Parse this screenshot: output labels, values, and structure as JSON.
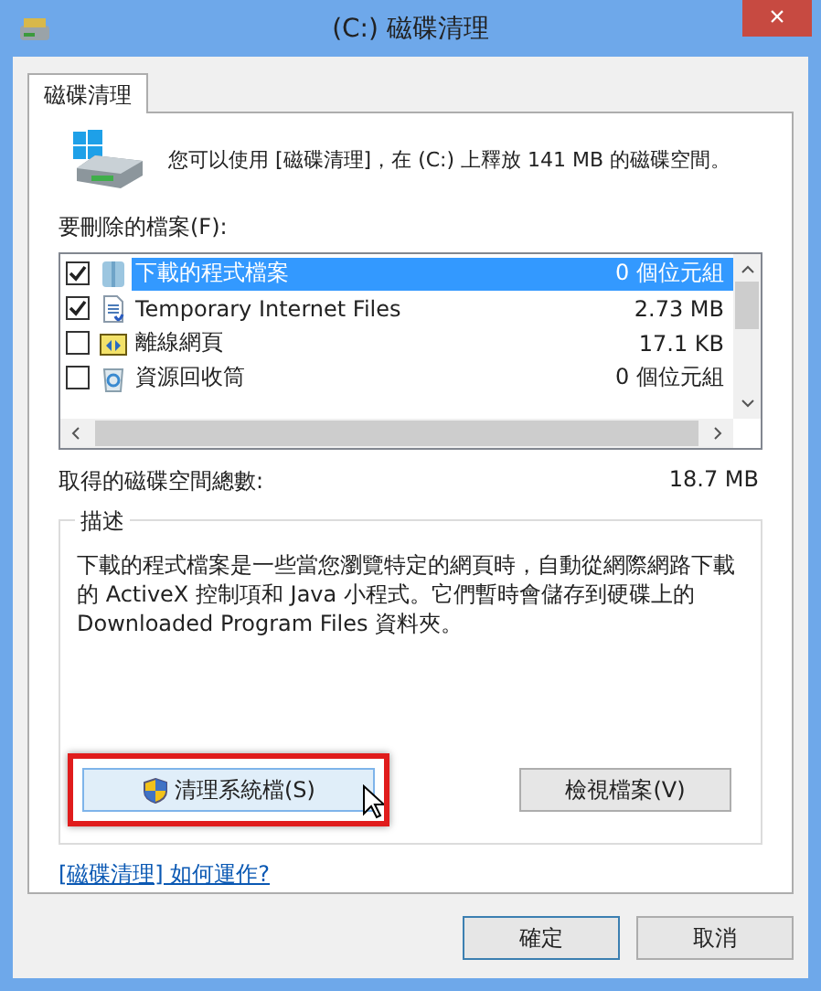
{
  "window": {
    "title": "(C:) 磁碟清理",
    "close": "×"
  },
  "tabs": [
    {
      "label": "磁碟清理",
      "selected": true
    }
  ],
  "intro": "您可以使用 [磁碟清理]，在 (C:) 上釋放 141 MB 的磁碟空間。",
  "files_label": "要刪除的檔案(F):",
  "files": [
    {
      "kind": "folder",
      "label": "下載的程式檔案",
      "size": "0 個位元組",
      "checked": true,
      "selected": true
    },
    {
      "kind": "document",
      "label": "Temporary Internet Files",
      "size": "2.73 MB",
      "checked": true,
      "selected": false
    },
    {
      "kind": "webpage",
      "label": "離線網頁",
      "size": "17.1 KB",
      "checked": false,
      "selected": false
    },
    {
      "kind": "recycle",
      "label": "資源回收筒",
      "size": "0 個位元組",
      "checked": false,
      "selected": false
    }
  ],
  "total": {
    "label": "取得的磁碟空間總數:",
    "value": "18.7 MB"
  },
  "description": {
    "title": "描述",
    "text": "下載的程式檔案是一些當您瀏覽特定的網頁時，自動從網際網路下載的 ActiveX 控制項和 Java 小程式。它們暫時會儲存到硬碟上的 Downloaded Program Files 資料夾。"
  },
  "clean_button": {
    "label": "清理系統檔(S)",
    "highlighted": true
  },
  "view_button": "檢視檔案(V)",
  "help_link": "[磁碟清理] 如何運作?",
  "buttons": [
    {
      "label": "確定",
      "default": true
    },
    {
      "label": "取消",
      "default": false
    }
  ]
}
